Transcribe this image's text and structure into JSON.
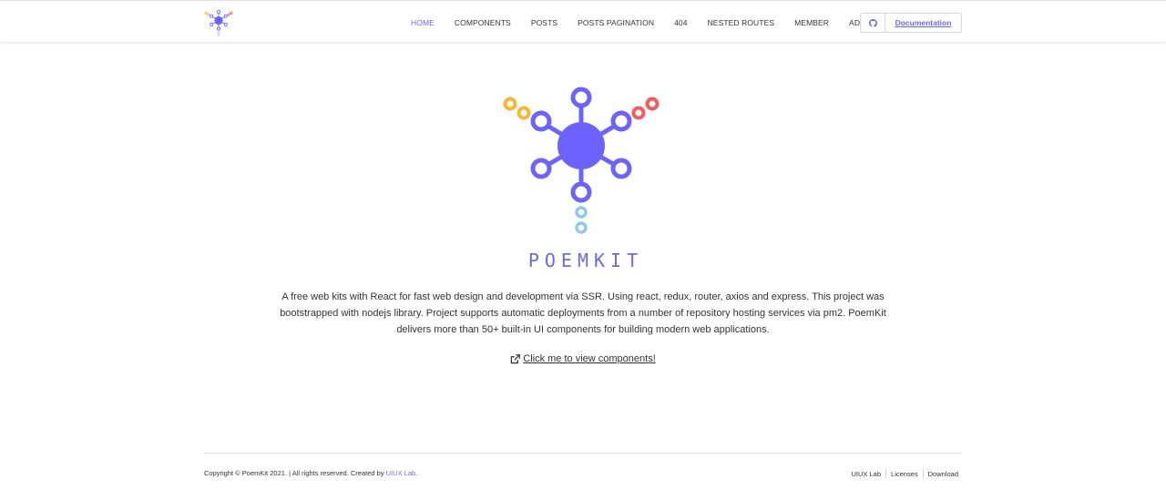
{
  "header": {
    "nav": [
      {
        "label": "HOME",
        "active": true
      },
      {
        "label": "COMPONENTS"
      },
      {
        "label": "POSTS"
      },
      {
        "label": "POSTS PAGINATION"
      },
      {
        "label": "404"
      },
      {
        "label": "NESTED ROUTES"
      },
      {
        "label": "MEMBER"
      },
      {
        "label": "ADMIN"
      }
    ],
    "github_icon": "github-icon",
    "doc_button": "Documentation"
  },
  "hero": {
    "brand": "POEMKIT",
    "description": "A free web kits with React for fast web design and development via SSR. Using react, redux, router, axios and express. This project was bootstrapped with nodejs library. Project supports automatic deployments from a number of repository hosting services via pm2. PoemKit delivers more than 50+ built-in UI components for building modern web applications.",
    "cta_icon": "external-link-icon",
    "cta_label": "Click me to view components!"
  },
  "footer": {
    "copyright_prefix": "Copyright © PoemKit 2021. | All rights reserved. Created by",
    "copyright_link": "UIUX Lab",
    "copyright_suffix": ".",
    "links": [
      "UIUX Lab",
      "Licenses",
      "Download"
    ]
  },
  "colors": {
    "accent": "#6a6ae8",
    "logo_purple": "#6c63ff",
    "logo_orange": "#f7b731",
    "logo_red": "#f25c5c",
    "logo_lightblue": "#8ec9f0"
  }
}
